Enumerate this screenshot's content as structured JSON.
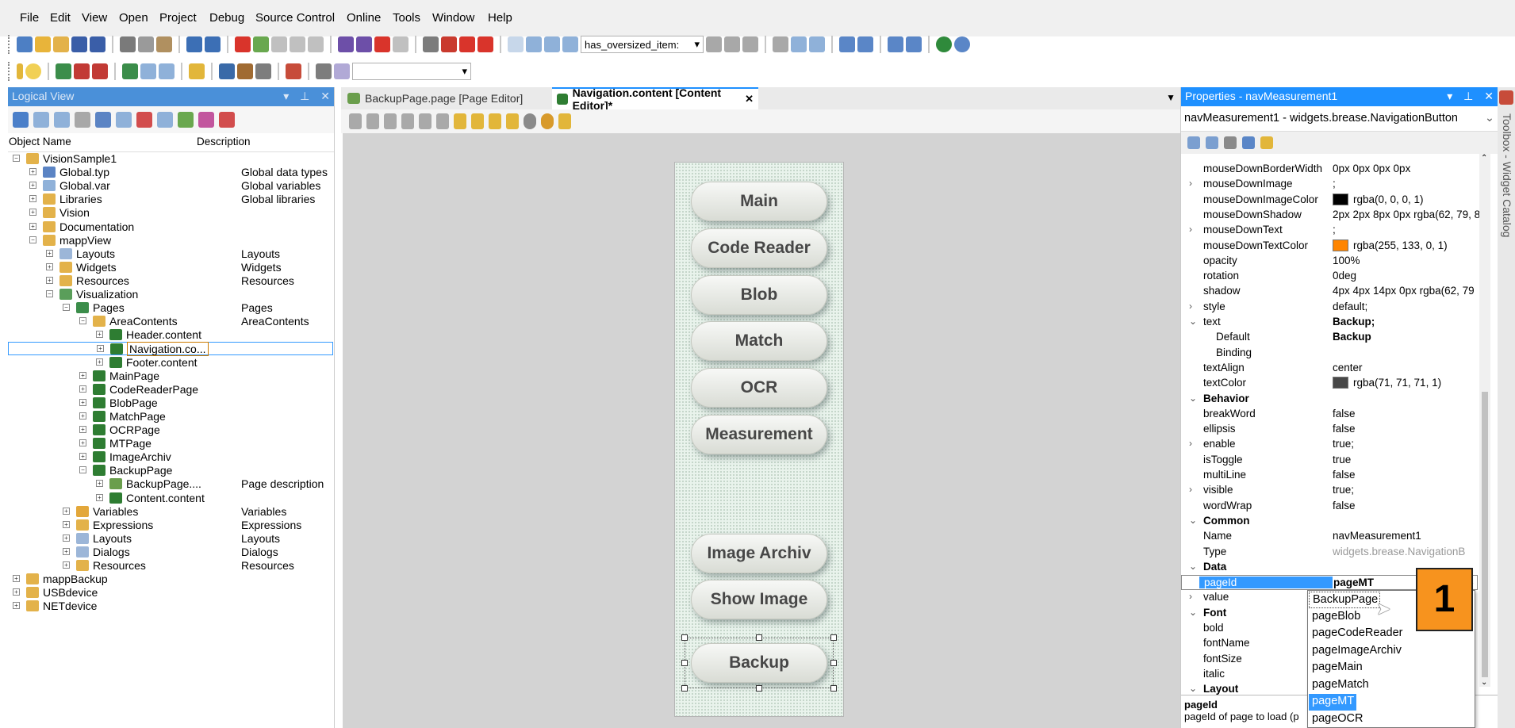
{
  "menu": [
    "File",
    "Edit",
    "View",
    "Open",
    "Project",
    "Debug",
    "Source Control",
    "Online",
    "Tools",
    "Window",
    "Help"
  ],
  "toolbar": {
    "filter_value": "has_oversized_item:"
  },
  "logical_view": {
    "title": "Logical View",
    "col_name": "Object Name",
    "col_desc": "Description",
    "tree": [
      {
        "label": "VisionSample1",
        "desc": ""
      },
      {
        "label": "Global.typ",
        "desc": "Global data types"
      },
      {
        "label": "Global.var",
        "desc": "Global variables"
      },
      {
        "label": "Libraries",
        "desc": "Global libraries"
      },
      {
        "label": "Vision",
        "desc": ""
      },
      {
        "label": "Documentation",
        "desc": ""
      },
      {
        "label": "mappView",
        "desc": ""
      },
      {
        "label": "Layouts",
        "desc": "Layouts"
      },
      {
        "label": "Widgets",
        "desc": "Widgets"
      },
      {
        "label": "Resources",
        "desc": "Resources"
      },
      {
        "label": "Visualization",
        "desc": ""
      },
      {
        "label": "Pages",
        "desc": "Pages"
      },
      {
        "label": "AreaContents",
        "desc": "AreaContents"
      },
      {
        "label": "Header.content",
        "desc": ""
      },
      {
        "label": "Navigation.co...",
        "desc": ""
      },
      {
        "label": "Footer.content",
        "desc": ""
      },
      {
        "label": "MainPage",
        "desc": ""
      },
      {
        "label": "CodeReaderPage",
        "desc": ""
      },
      {
        "label": "BlobPage",
        "desc": ""
      },
      {
        "label": "MatchPage",
        "desc": ""
      },
      {
        "label": "OCRPage",
        "desc": ""
      },
      {
        "label": "MTPage",
        "desc": ""
      },
      {
        "label": "ImageArchiv",
        "desc": ""
      },
      {
        "label": "BackupPage",
        "desc": ""
      },
      {
        "label": "BackupPage....",
        "desc": "Page description"
      },
      {
        "label": "Content.content",
        "desc": ""
      },
      {
        "label": "Variables",
        "desc": "Variables"
      },
      {
        "label": "Expressions",
        "desc": "Expressions"
      },
      {
        "label": "Layouts",
        "desc": "Layouts"
      },
      {
        "label": "Dialogs",
        "desc": "Dialogs"
      },
      {
        "label": "Resources",
        "desc": "Resources"
      },
      {
        "label": "mappBackup",
        "desc": ""
      },
      {
        "label": "USBdevice",
        "desc": ""
      },
      {
        "label": "NETdevice",
        "desc": ""
      }
    ]
  },
  "editor": {
    "tabs": [
      {
        "label": "BackupPage.page [Page Editor]",
        "active": false
      },
      {
        "label": "Navigation.content [Content Editor]*",
        "active": true
      }
    ],
    "close_glyph": "✕",
    "nav_buttons": [
      "Main",
      "Code Reader",
      "Blob",
      "Match",
      "OCR",
      "Measurement",
      "Image Archiv",
      "Show Image",
      "Backup"
    ]
  },
  "properties": {
    "title": "Properties - navMeasurement1",
    "object": "navMeasurement1 - widgets.brease.NavigationButton",
    "rows": [
      {
        "kind": "prop",
        "name": "mouseDownBorderWidth",
        "value": "0px 0px 0px 0px"
      },
      {
        "kind": "prop",
        "name": "mouseDownImage",
        "value": ";",
        "expand": true
      },
      {
        "kind": "prop",
        "name": "mouseDownImageColor",
        "value": "rgba(0, 0, 0, 1)",
        "swatch": "#000000"
      },
      {
        "kind": "prop",
        "name": "mouseDownShadow",
        "value": "2px 2px 8px 0px rgba(62, 79, 8"
      },
      {
        "kind": "prop",
        "name": "mouseDownText",
        "value": ";",
        "expand": true
      },
      {
        "kind": "prop",
        "name": "mouseDownTextColor",
        "value": "rgba(255, 133, 0, 1)",
        "swatch": "#ff8500"
      },
      {
        "kind": "prop",
        "name": "opacity",
        "value": "100%"
      },
      {
        "kind": "prop",
        "name": "rotation",
        "value": "0deg"
      },
      {
        "kind": "prop",
        "name": "shadow",
        "value": "4px 4px 14px 0px rgba(62, 79"
      },
      {
        "kind": "prop",
        "name": "style",
        "value": "default;",
        "expand": true
      },
      {
        "kind": "prop",
        "name": "text",
        "value": "Backup;",
        "bold": true,
        "expanded": true
      },
      {
        "kind": "sub",
        "name": "Default",
        "value": "Backup",
        "bold": true
      },
      {
        "kind": "sub",
        "name": "Binding",
        "value": ""
      },
      {
        "kind": "prop",
        "name": "textAlign",
        "value": "center"
      },
      {
        "kind": "prop",
        "name": "textColor",
        "value": "rgba(71, 71, 71, 1)",
        "swatch": "#474747"
      },
      {
        "kind": "cat",
        "name": "Behavior"
      },
      {
        "kind": "prop",
        "name": "breakWord",
        "value": "false"
      },
      {
        "kind": "prop",
        "name": "ellipsis",
        "value": "false"
      },
      {
        "kind": "prop",
        "name": "enable",
        "value": "true;",
        "expand": true
      },
      {
        "kind": "prop",
        "name": "isToggle",
        "value": "true"
      },
      {
        "kind": "prop",
        "name": "multiLine",
        "value": "false"
      },
      {
        "kind": "prop",
        "name": "visible",
        "value": "true;",
        "expand": true
      },
      {
        "kind": "prop",
        "name": "wordWrap",
        "value": "false"
      },
      {
        "kind": "cat",
        "name": "Common"
      },
      {
        "kind": "prop",
        "name": "Name",
        "value": "navMeasurement1"
      },
      {
        "kind": "prop",
        "name": "Type",
        "value": "widgets.brease.NavigationB",
        "muted": true
      },
      {
        "kind": "cat",
        "name": "Data"
      },
      {
        "kind": "prop",
        "name": "pageId",
        "value": "pageMT",
        "bold": true,
        "selected": true
      },
      {
        "kind": "prop",
        "name": "value",
        "value": "",
        "expand": true
      },
      {
        "kind": "cat",
        "name": "Font"
      },
      {
        "kind": "prop",
        "name": "bold",
        "value": ""
      },
      {
        "kind": "prop",
        "name": "fontName",
        "value": ""
      },
      {
        "kind": "prop",
        "name": "fontSize",
        "value": ""
      },
      {
        "kind": "prop",
        "name": "italic",
        "value": ""
      },
      {
        "kind": "cat",
        "name": "Layout"
      }
    ],
    "desc_title": "pageId",
    "desc_text": "pageId of page to load (p",
    "dropdown_options": [
      "BackupPage",
      "pageBlob",
      "pageCodeReader",
      "pageImageArchiv",
      "pageMain",
      "pageMatch",
      "pageMT",
      "pageOCR"
    ],
    "dropdown_selected": "pageMT"
  },
  "toolbox": {
    "label": "Toolbox - Widget Catalog"
  },
  "annotation": {
    "step": "1"
  },
  "colors": {
    "accent": "#1e90ff",
    "selection": "#3399ff",
    "badge": "#f7931e",
    "button_text": "#474747"
  }
}
